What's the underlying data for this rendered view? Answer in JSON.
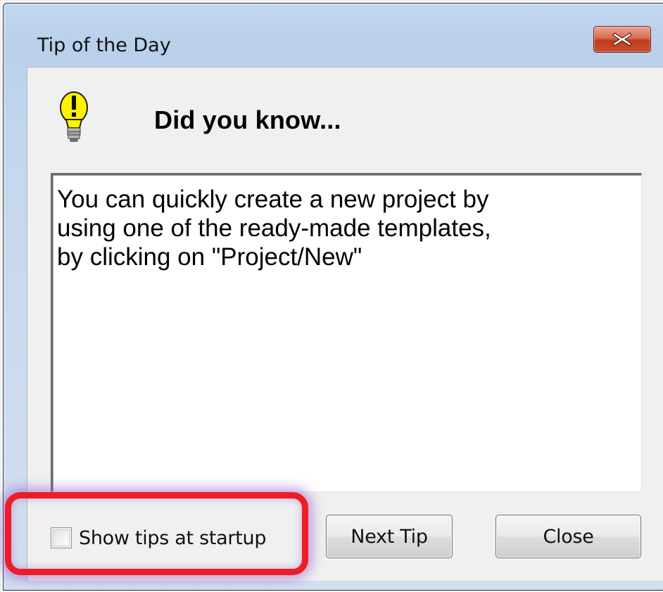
{
  "window": {
    "title": "Tip of the Day",
    "close_icon": "close-x-icon"
  },
  "header": {
    "icon": "lightbulb-icon",
    "heading": "Did you know..."
  },
  "tip": {
    "text": "You can quickly create a new project by\nusing one of the ready-made templates,\nby clicking on \"Project/New\""
  },
  "footer": {
    "show_tips_label": "Show tips at startup",
    "show_tips_checked": false,
    "next_tip_label": "Next Tip",
    "close_label": "Close"
  },
  "colors": {
    "highlight": "#ee1c24",
    "close_button": "#c84f31"
  }
}
